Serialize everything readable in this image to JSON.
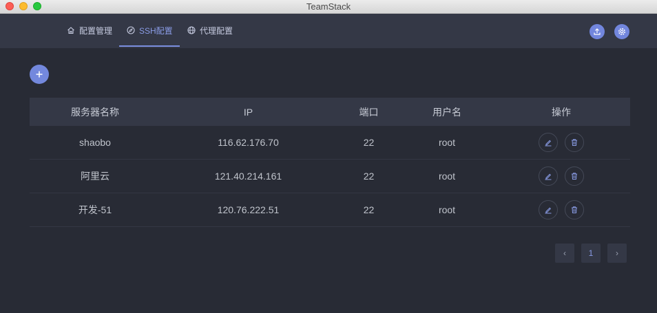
{
  "window": {
    "title": "TeamStack"
  },
  "nav": {
    "tabs": [
      {
        "label": "配置管理",
        "icon": "home-icon"
      },
      {
        "label": "SSH配置",
        "icon": "compass-icon"
      },
      {
        "label": "代理配置",
        "icon": "globe-icon"
      }
    ],
    "active_tab": "SSH配置",
    "actions": [
      {
        "icon": "upload-icon"
      },
      {
        "icon": "gear-icon"
      }
    ]
  },
  "add_button": {
    "icon": "plus-icon"
  },
  "table": {
    "columns": [
      "服务器名称",
      "IP",
      "端口",
      "用户名",
      "操作"
    ],
    "rows": [
      {
        "name": "shaobo",
        "ip": "116.62.176.70",
        "port": "22",
        "user": "root"
      },
      {
        "name": "阿里云",
        "ip": "121.40.214.161",
        "port": "22",
        "user": "root"
      },
      {
        "name": "开发-51",
        "ip": "120.76.222.51",
        "port": "22",
        "user": "root"
      }
    ],
    "row_actions": [
      {
        "icon": "edit-icon"
      },
      {
        "icon": "trash-icon"
      }
    ]
  },
  "pagination": {
    "prev": "‹",
    "current": "1",
    "next": "›"
  },
  "colors": {
    "accent": "#7286dd",
    "background": "#282b35",
    "header": "#343846"
  }
}
